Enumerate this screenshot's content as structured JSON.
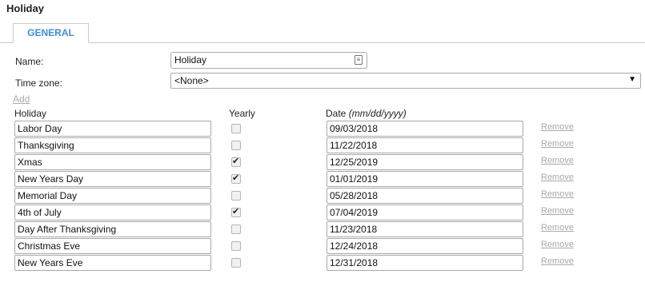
{
  "page": {
    "title": "Holiday"
  },
  "tabs": [
    {
      "label": "GENERAL"
    }
  ],
  "form": {
    "name_label": "Name:",
    "name_value": "Holiday",
    "timezone_label": "Time zone:",
    "timezone_value": "<None>",
    "add_link": "Add"
  },
  "table": {
    "headers": {
      "holiday": "Holiday",
      "yearly": "Yearly",
      "date": "Date",
      "date_format": "(mm/dd/yyyy)"
    },
    "remove_label": "Remove",
    "rows": [
      {
        "name": "Labor Day",
        "yearly": false,
        "date": "09/03/2018"
      },
      {
        "name": "Thanksgiving",
        "yearly": false,
        "date": "11/22/2018"
      },
      {
        "name": "Xmas",
        "yearly": true,
        "date": "12/25/2019"
      },
      {
        "name": "New Years Day",
        "yearly": true,
        "date": "01/01/2019"
      },
      {
        "name": "Memorial Day",
        "yearly": false,
        "date": "05/28/2018"
      },
      {
        "name": "4th of July",
        "yearly": true,
        "date": "07/04/2019"
      },
      {
        "name": "Day After Thanksgiving",
        "yearly": false,
        "date": "11/23/2018"
      },
      {
        "name": "Christmas Eve",
        "yearly": false,
        "date": "12/24/2018"
      },
      {
        "name": "New Years Eve",
        "yearly": false,
        "date": "12/31/2018"
      }
    ]
  },
  "colors": {
    "tab_accent": "#3b8ed6",
    "link_muted": "#aaaaaa"
  },
  "icons": {
    "name_field": "contact-card-icon",
    "timezone": "dropdown-arrow-icon"
  }
}
